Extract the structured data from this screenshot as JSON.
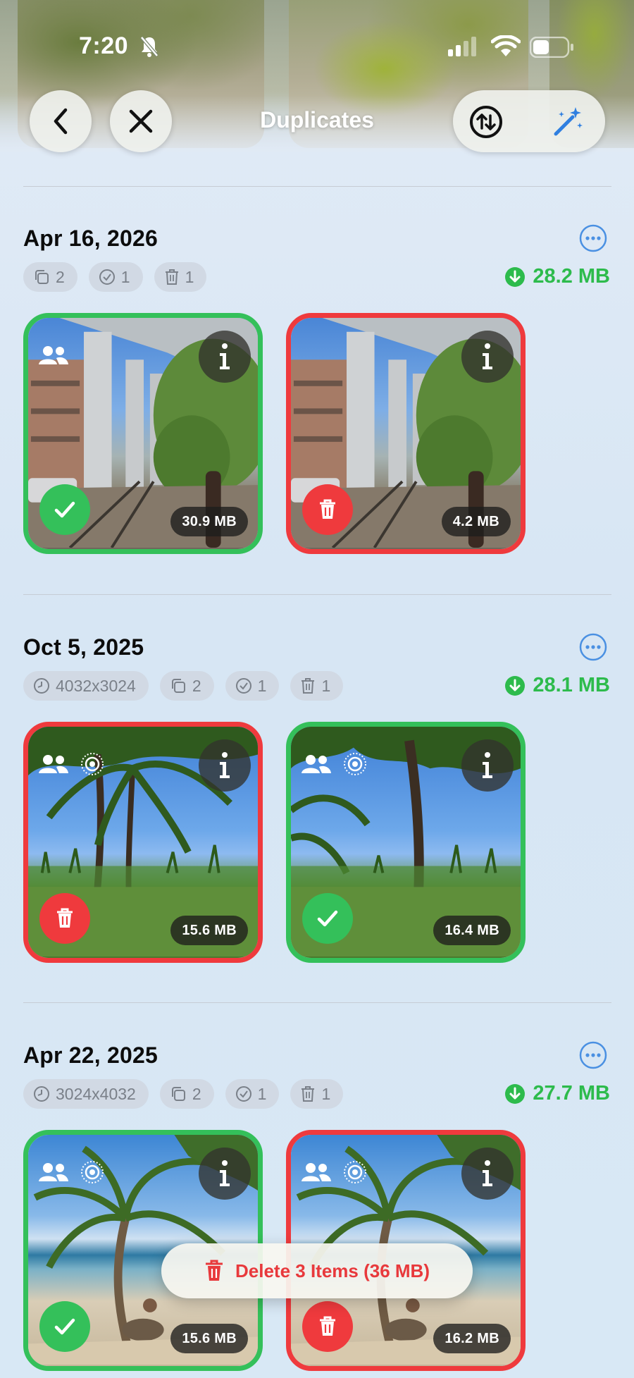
{
  "status_bar": {
    "time": "7:20"
  },
  "nav": {
    "title": "Duplicates"
  },
  "groups": [
    {
      "date": "Apr 16, 2026",
      "chips": {
        "resolution": null,
        "count": "2",
        "keep": "1",
        "delete": "1"
      },
      "savings": "28.2 MB",
      "items": [
        {
          "state": "keep",
          "size": "30.9 MB",
          "people": true,
          "live": false
        },
        {
          "state": "delete",
          "size": "4.2 MB",
          "people": false,
          "live": false
        }
      ]
    },
    {
      "date": "Oct 5, 2025",
      "chips": {
        "resolution": "4032x3024",
        "count": "2",
        "keep": "1",
        "delete": "1"
      },
      "savings": "28.1 MB",
      "items": [
        {
          "state": "delete",
          "size": "15.6 MB",
          "people": true,
          "live": true
        },
        {
          "state": "keep",
          "size": "16.4 MB",
          "people": true,
          "live": true
        }
      ]
    },
    {
      "date": "Apr 22, 2025",
      "chips": {
        "resolution": "3024x4032",
        "count": "2",
        "keep": "1",
        "delete": "1"
      },
      "savings": "27.7 MB",
      "items": [
        {
          "state": "keep",
          "size": "15.6 MB",
          "people": true,
          "live": true
        },
        {
          "state": "delete",
          "size": "16.2 MB",
          "people": true,
          "live": true
        }
      ]
    }
  ],
  "delete_button": {
    "label": "Delete 3 Items (36 MB)"
  },
  "colors": {
    "keep": "#34c05a",
    "delete": "#ef3a3d",
    "accent": "#4a90e2",
    "savings": "#2dbb4c"
  },
  "icons": [
    "bell-slash-icon",
    "cellular-icon",
    "wifi-icon",
    "battery-icon",
    "chevron-left-icon",
    "close-icon",
    "sort-icon",
    "magic-wand-icon",
    "more-icon",
    "copy-icon",
    "checkmark-circle-icon",
    "trash-icon",
    "clock-icon",
    "download-icon",
    "info-icon",
    "people-icon",
    "live-photo-icon"
  ]
}
